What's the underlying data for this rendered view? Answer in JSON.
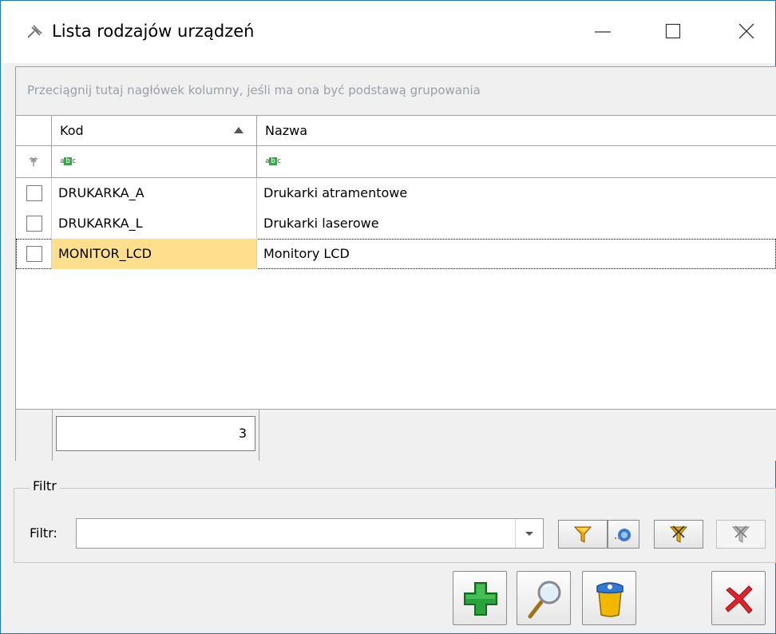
{
  "window": {
    "title": "Lista rodzajów urządzeń",
    "controls": {
      "minimize": "minimize-icon",
      "maximize": "maximize-icon",
      "close": "close-icon"
    }
  },
  "grid": {
    "group_panel_text": "Przeciągnij tutaj nagłówek kolumny, jeśli ma ona być podstawą grupowania",
    "columns": [
      {
        "label": "Kod",
        "sort": "ascending"
      },
      {
        "label": "Nazwa"
      }
    ],
    "filter_row_icon": "abc-text-filter-icon",
    "rows": [
      {
        "kod": "DRUKARKA_A",
        "nazwa": "Drukarki atramentowe",
        "checked": false,
        "selected": false
      },
      {
        "kod": "DRUKARKA_L",
        "nazwa": "Drukarki laserowe",
        "checked": false,
        "selected": false
      },
      {
        "kod": "MONITOR_LCD",
        "nazwa": "Monitory LCD",
        "checked": false,
        "selected": true
      }
    ],
    "footer_count": "3"
  },
  "filter": {
    "group_label": "Filtr",
    "label": "Filtr:",
    "value": "",
    "toolbar": [
      "filter-funnel-icon",
      "filter-refresh-icon",
      "filter-advanced-icon",
      "filter-clear-icon"
    ]
  },
  "actions": [
    "add-icon",
    "preview-magnifier-icon",
    "delete-trash-icon",
    "close-x-icon"
  ],
  "colors": {
    "selection": "#fddf8e",
    "window_border": "#1a73c9",
    "add_green": "#2aa33b",
    "close_red": "#e0242b"
  }
}
